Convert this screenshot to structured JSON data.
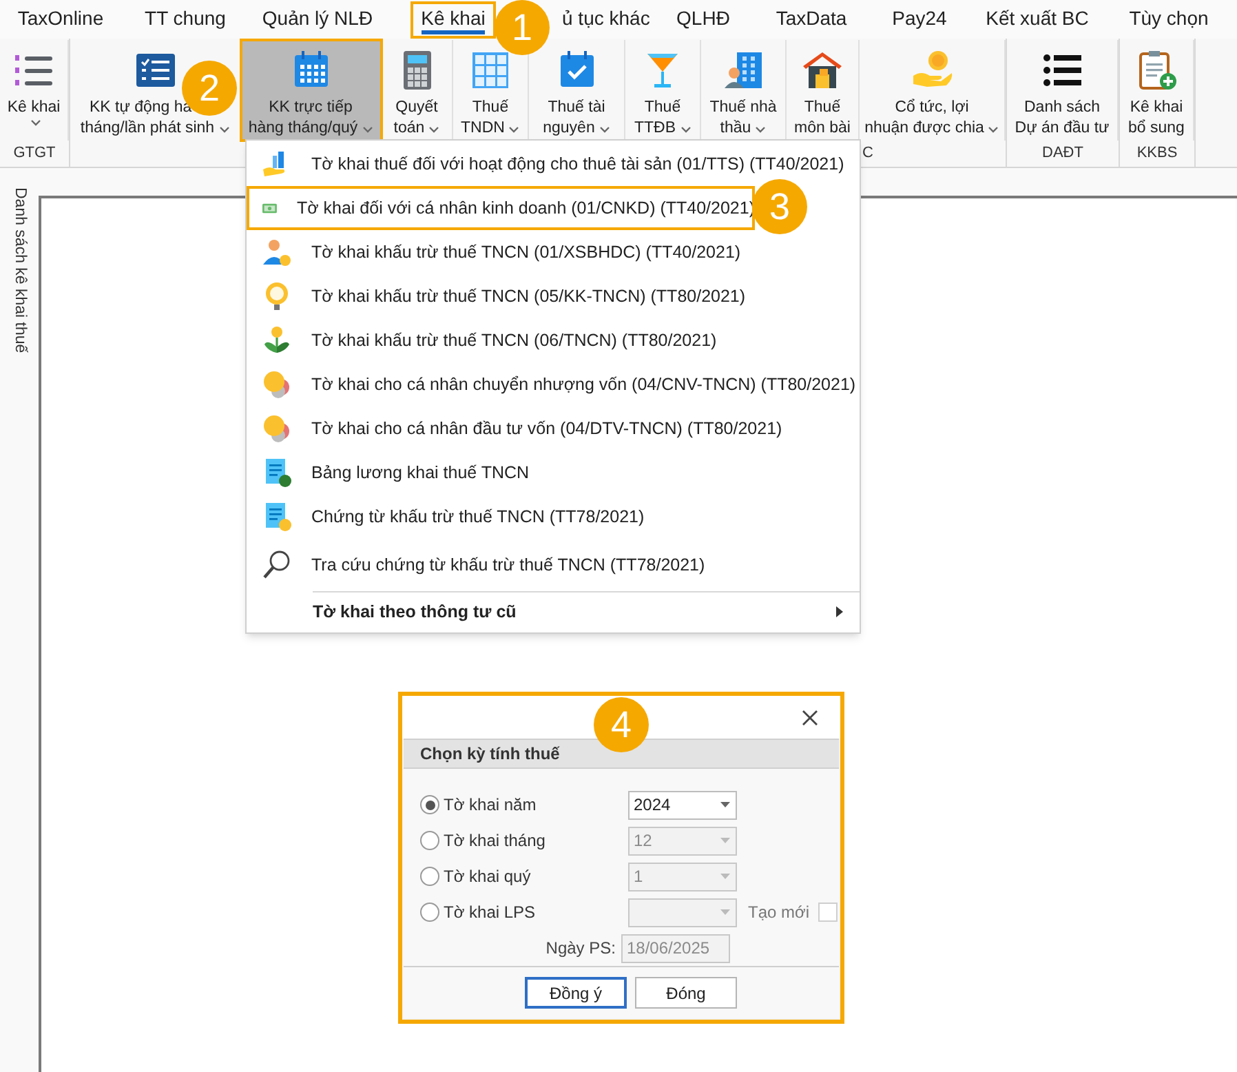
{
  "tabs": [
    {
      "label": "TaxOnline",
      "selected": false,
      "highlighted": false
    },
    {
      "label": "TT chung",
      "selected": false,
      "highlighted": false
    },
    {
      "label": "Quản lý NLĐ",
      "selected": false,
      "highlighted": false
    },
    {
      "label": "Kê khai",
      "selected": true,
      "highlighted": true
    },
    {
      "label": "ủ tục khác",
      "selected": false,
      "highlighted": false
    },
    {
      "label": "QLHĐ",
      "selected": false,
      "highlighted": false
    },
    {
      "label": "TaxData",
      "selected": false,
      "highlighted": false
    },
    {
      "label": "Pay24",
      "selected": false,
      "highlighted": false
    },
    {
      "label": "Kết xuất BC",
      "selected": false,
      "highlighted": false
    },
    {
      "label": "Tùy chọn",
      "selected": false,
      "highlighted": false
    }
  ],
  "ribbon": {
    "groups": [
      {
        "label": "GTGT",
        "buttons": [
          {
            "lines": [
              "Kê khai"
            ],
            "dropdown": true,
            "selected": false,
            "highlighted": false
          }
        ]
      },
      {
        "label": "C",
        "buttons": [
          {
            "lines": [
              "KK tự động hà",
              "tháng/lần phát sinh"
            ],
            "dropdown": true,
            "selected": false,
            "highlighted": false
          },
          {
            "lines": [
              "KK trực tiếp",
              "hàng tháng/quý"
            ],
            "dropdown": true,
            "selected": true,
            "highlighted": true
          },
          {
            "lines": [
              "Quyết",
              "toán"
            ],
            "dropdown": true,
            "selected": false,
            "highlighted": false
          },
          {
            "lines": [
              "Thuế",
              "TNDN"
            ],
            "dropdown": true,
            "selected": false,
            "highlighted": false
          },
          {
            "lines": [
              "Thuế tài",
              "nguyên"
            ],
            "dropdown": true,
            "selected": false,
            "highlighted": false
          },
          {
            "lines": [
              "Thuế",
              "TTĐB"
            ],
            "dropdown": true,
            "selected": false,
            "highlighted": false
          },
          {
            "lines": [
              "Thuế nhà",
              "thầu"
            ],
            "dropdown": true,
            "selected": false,
            "highlighted": false
          },
          {
            "lines": [
              "Thuế",
              "môn bài"
            ],
            "dropdown": false,
            "selected": false,
            "highlighted": false
          },
          {
            "lines": [
              "Cổ tức, lợi",
              "nhuận được chia"
            ],
            "dropdown": true,
            "selected": false,
            "highlighted": false
          }
        ]
      },
      {
        "label": "DAĐT",
        "buttons": [
          {
            "lines": [
              "Danh sách",
              "Dự án đầu tư"
            ],
            "dropdown": false,
            "selected": false,
            "highlighted": false
          }
        ]
      },
      {
        "label": "KKBS",
        "buttons": [
          {
            "lines": [
              "Kê khai",
              "bổ sung"
            ],
            "dropdown": false,
            "selected": false,
            "highlighted": false
          }
        ]
      }
    ]
  },
  "side_panel": {
    "title": "Danh sách kê khai thuế"
  },
  "menu": {
    "items": [
      {
        "label": "Tờ khai thuế đối với hoạt động cho thuê tài sản (01/TTS) (TT40/2021)",
        "highlighted": false
      },
      {
        "label": "Tờ khai đối với cá nhân kinh doanh (01/CNKD) (TT40/2021)",
        "highlighted": true
      },
      {
        "label": "Tờ khai khấu trừ thuế TNCN (01/XSBHDC) (TT40/2021)",
        "highlighted": false
      },
      {
        "label": "Tờ khai khấu trừ thuế TNCN (05/KK-TNCN) (TT80/2021)",
        "highlighted": false
      },
      {
        "label": "Tờ khai khấu trừ thuế TNCN (06/TNCN) (TT80/2021)",
        "highlighted": false
      },
      {
        "label": "Tờ khai cho cá nhân chuyển nhượng vốn (04/CNV-TNCN) (TT80/2021)",
        "highlighted": false
      },
      {
        "label": "Tờ khai cho cá nhân đầu tư vốn (04/DTV-TNCN) (TT80/2021)",
        "highlighted": false
      },
      {
        "label": "Bảng lương khai thuế TNCN",
        "highlighted": false
      },
      {
        "label": "Chứng từ khấu trừ thuế TNCN (TT78/2021)",
        "highlighted": false
      },
      {
        "label": "Tra cứu chứng từ khấu trừ thuế TNCN (TT78/2021)",
        "highlighted": false
      }
    ],
    "submenu": {
      "label": "Tờ khai theo thông tư cũ"
    }
  },
  "dialog": {
    "highlighted": true,
    "section_title": "Chọn kỳ tính thuế",
    "options": [
      {
        "label": "Tờ khai năm",
        "selected": true,
        "value": "2024",
        "disabled": false
      },
      {
        "label": "Tờ khai tháng",
        "selected": false,
        "value": "12",
        "disabled": true
      },
      {
        "label": "Tờ khai quý",
        "selected": false,
        "value": "1",
        "disabled": true
      },
      {
        "label": "Tờ khai LPS",
        "selected": false,
        "disabled": true
      }
    ],
    "new_checkbox": {
      "label": "Tạo mới",
      "checked": false
    },
    "date_label": "Ngày PS:",
    "date_value": "18/06/2025",
    "buttons": [
      {
        "label": "Đồng ý",
        "focused": true
      },
      {
        "label": "Đóng",
        "focused": false
      }
    ]
  },
  "callouts": [
    {
      "label": "1"
    },
    {
      "label": "2"
    },
    {
      "label": "3"
    },
    {
      "label": "4"
    }
  ]
}
